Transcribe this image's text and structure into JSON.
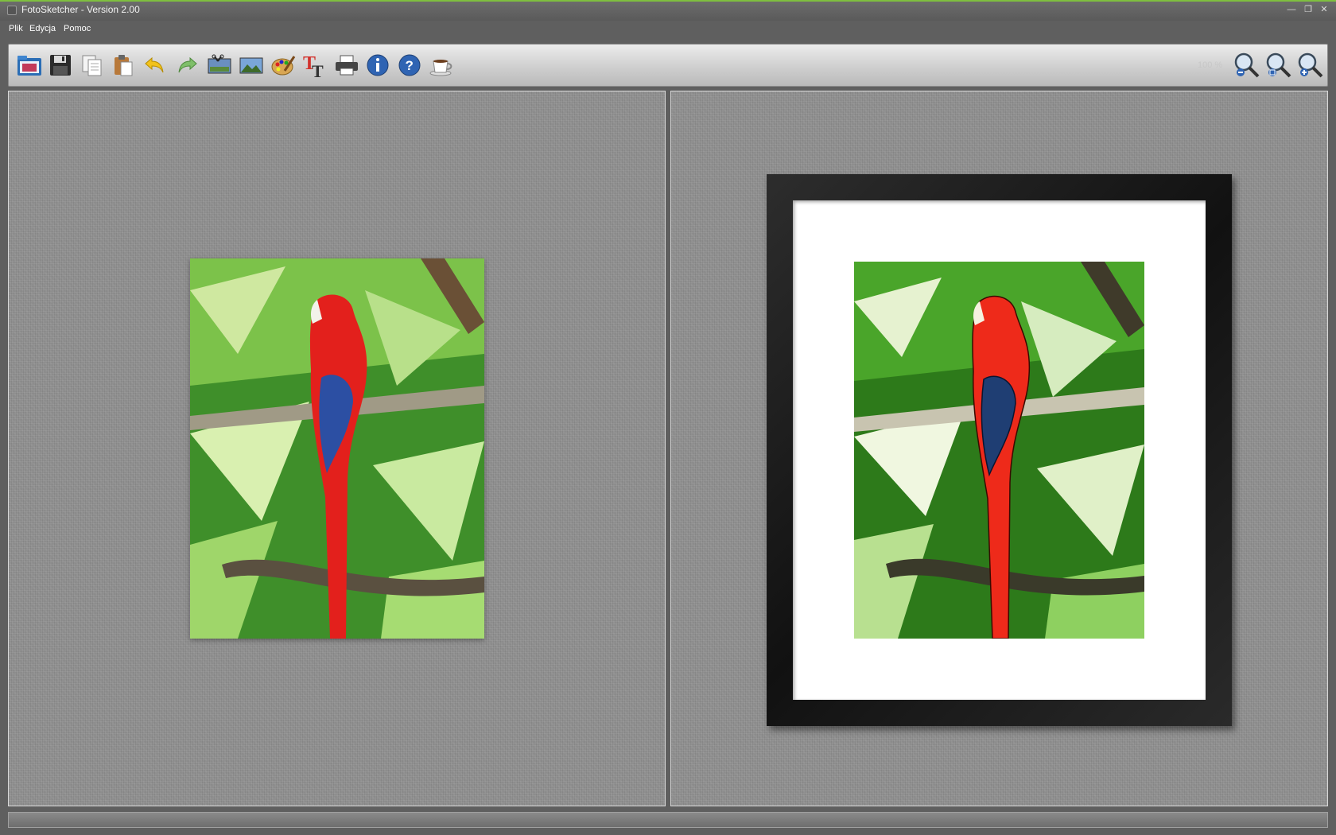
{
  "window": {
    "title": "FotoSketcher - Version 2.00",
    "accent": "#7fbf3f"
  },
  "menu": {
    "items": [
      "Plik",
      "Edycja",
      "Pomoc"
    ]
  },
  "toolbar": {
    "buttons": [
      {
        "icon": "open-folder-icon"
      },
      {
        "icon": "save-floppy-icon"
      },
      {
        "icon": "copy-icon"
      },
      {
        "icon": "paste-icon"
      },
      {
        "icon": "undo-arrow-icon"
      },
      {
        "icon": "redo-arrow-icon"
      },
      {
        "icon": "crop-image-icon"
      },
      {
        "icon": "landscape-image-icon"
      },
      {
        "icon": "palette-icon"
      },
      {
        "icon": "text-icon"
      },
      {
        "icon": "printer-icon"
      },
      {
        "icon": "info-icon"
      },
      {
        "icon": "help-icon"
      },
      {
        "icon": "coffee-cup-icon"
      }
    ],
    "zoom_level": "100 %",
    "zoom_buttons": [
      {
        "icon": "zoom-out-icon"
      },
      {
        "icon": "zoom-reset-icon"
      },
      {
        "icon": "zoom-in-icon"
      }
    ]
  },
  "panels": {
    "left": {
      "content": "original photo of red macaw on branch in jungle"
    },
    "right": {
      "content": "sketched/painted version in black frame with white mat"
    }
  },
  "status": {
    "text": ""
  }
}
